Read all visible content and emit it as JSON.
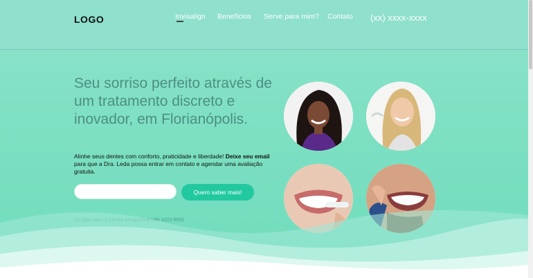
{
  "header": {
    "logo": "LOGO",
    "nav": [
      {
        "label": "Invisalign"
      },
      {
        "label": "Benefícios"
      },
      {
        "label": "Serve para mim?"
      },
      {
        "label": "Contato"
      }
    ],
    "phone": "(xx) xxxx-xxxx"
  },
  "hero": {
    "headline": "Seu sorriso perfeito através de um tratamento discreto e inovador, em Florianópolis.",
    "subtext_part1": "Alinhe seus dentes com conforto, praticidade e liberdade! ",
    "subtext_bold": "Deixe seu email",
    "subtext_part2": " para que a Dra. Leda possa entrar em contato e agendar uma avaliação gratuita.",
    "email_placeholder": "",
    "cta_label": "Quero saber mais!",
    "contact_line": "Ou ligue para a Clínica Monguilhott (48) 3222-6591"
  },
  "colors": {
    "accent": "#22c9a0",
    "headline": "#4c8f82",
    "background": "#8fe3cc"
  },
  "images": [
    {
      "name": "woman-curly-hair-aligner-photo"
    },
    {
      "name": "blonde-woman-aligner-photo"
    },
    {
      "name": "smile-inserting-aligner-photo"
    },
    {
      "name": "man-smile-aligner-photo"
    }
  ]
}
